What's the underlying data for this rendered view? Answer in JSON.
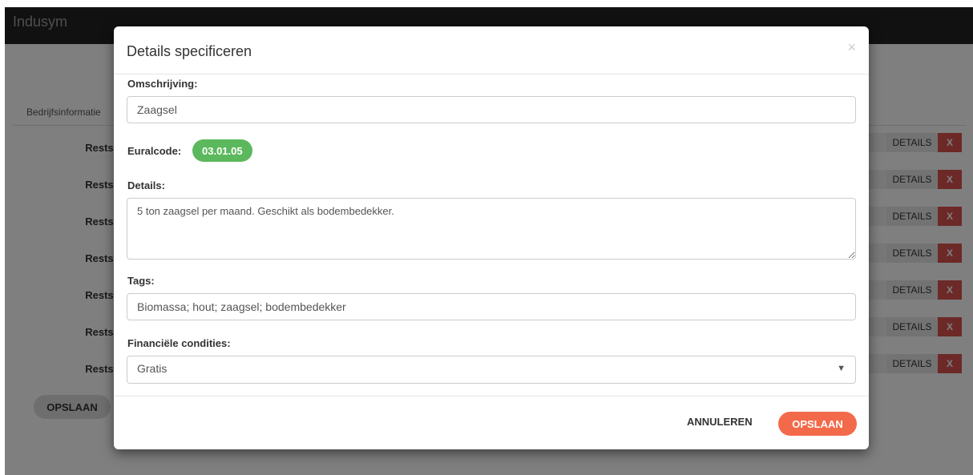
{
  "app": {
    "brand": "Indusym"
  },
  "background": {
    "tab_label": "Bedrijfsinformatie",
    "rows": [
      {
        "label": "Restst"
      },
      {
        "label": "Restst"
      },
      {
        "label": "Restst"
      },
      {
        "label": "Restst"
      },
      {
        "label": "Restst"
      },
      {
        "label": "Restst"
      },
      {
        "label": "Restst"
      }
    ],
    "details_label": "DETAILS",
    "delete_label": "X",
    "save_label": "OPSLAAN"
  },
  "modal": {
    "title": "Details specificeren",
    "close_symbol": "×",
    "description_label": "Omschrijving:",
    "description_value": "Zaagsel",
    "euralcode_label": "Euralcode:",
    "euralcode_value": "03.01.05",
    "details_label": "Details:",
    "details_value": "5 ton zaagsel per maand. Geschikt als bodembedekker.",
    "tags_label": "Tags:",
    "tags_value": "Biomassa; hout; zaagsel; bodembedekker",
    "financial_label": "Financiële condities:",
    "financial_value": "Gratis",
    "cancel_label": "ANNULEREN",
    "save_label": "OPSLAAN"
  },
  "colors": {
    "navbar": "#222222",
    "badge": "#5cb85c",
    "save_button": "#f36a4a",
    "delete_button": "#d9534f"
  }
}
